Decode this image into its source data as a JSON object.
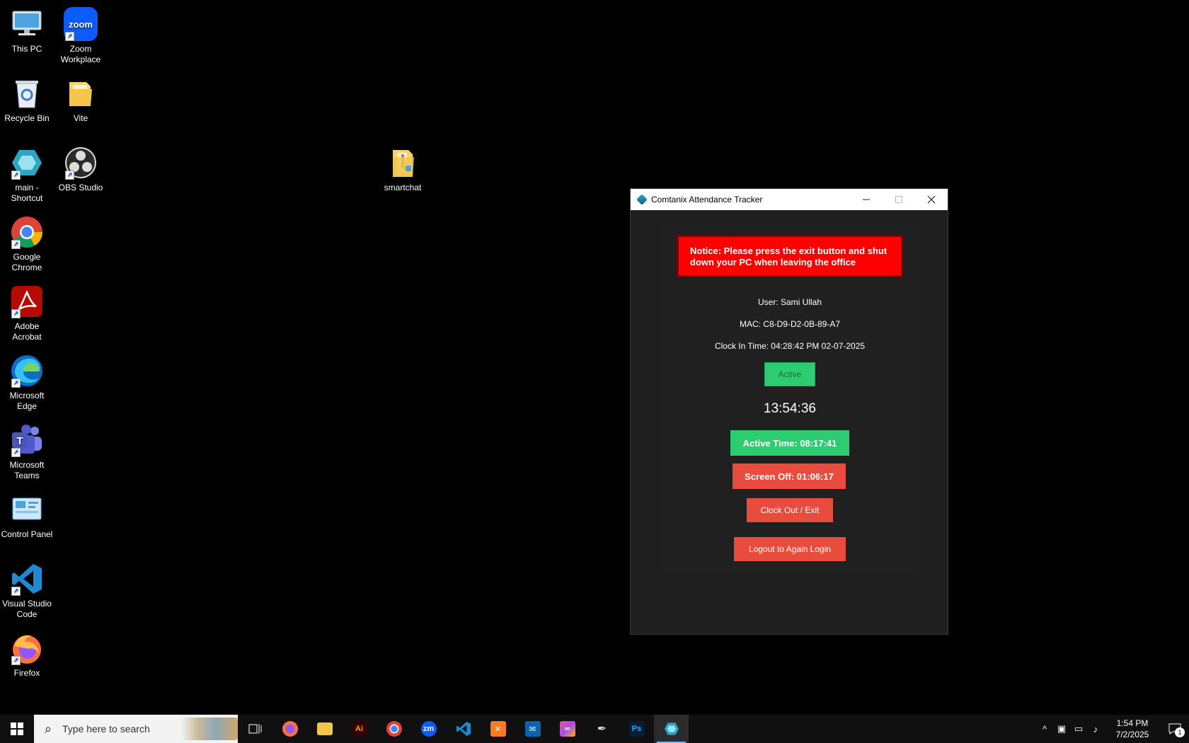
{
  "desktop": {
    "icons": [
      {
        "label": "This PC"
      },
      {
        "label": "Zoom Workplace"
      },
      {
        "label": "Recycle Bin"
      },
      {
        "label": "Vite"
      },
      {
        "label": "main - Shortcut"
      },
      {
        "label": "OBS Studio"
      },
      {
        "label": "Google Chrome"
      },
      {
        "label": "Adobe Acrobat"
      },
      {
        "label": "Microsoft Edge"
      },
      {
        "label": "Microsoft Teams"
      },
      {
        "label": "Control Panel"
      },
      {
        "label": "Visual Studio Code"
      },
      {
        "label": "Firefox"
      },
      {
        "label": "smartchat"
      }
    ],
    "zoom_logo_text": "zoom"
  },
  "window": {
    "title": "Comtanix Attendance Tracker",
    "notice": "Notice: Please press the exit button and shut down your PC when leaving the office",
    "user": "User: Sami Ullah",
    "mac": "MAC: C8-D9-D2-0B-89-A7",
    "clock_in": "Clock In Time: 04:28:42 PM 02-07-2025",
    "status": "Active",
    "current_time": "13:54:36",
    "active_time": "Active Time: 08:17:41",
    "screen_off": "Screen Off: 01:06:17",
    "clock_out_label": "Clock Out / Exit",
    "logout_label": "Logout to Again Login",
    "colors": {
      "notice": "#ff0000",
      "active": "#2ecc71",
      "danger": "#e74c3c"
    }
  },
  "taskbar": {
    "search_placeholder": "Type here to search",
    "illustrator_label": "Ai",
    "zoom_label": "zm",
    "photoshop_label": "Ps",
    "time": "1:54 PM",
    "date": "7/2/2025",
    "notification_count": "1"
  }
}
